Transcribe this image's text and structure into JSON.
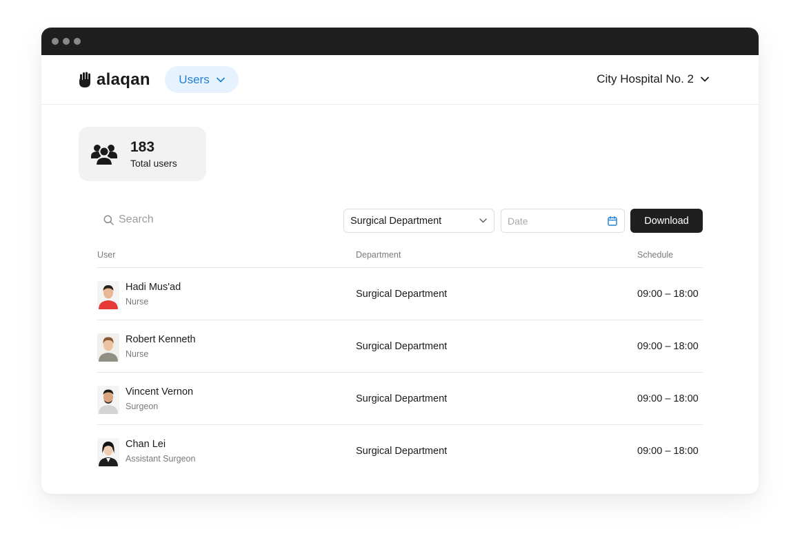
{
  "app": {
    "logo_text": "alaqan"
  },
  "nav": {
    "section_label": "Users"
  },
  "org": {
    "name": "City Hospital No. 2"
  },
  "stats": {
    "total_value": "183",
    "total_label": "Total users"
  },
  "filters": {
    "search_placeholder": "Search",
    "department_selected": "Surgical Department",
    "date_placeholder": "Date",
    "download_label": "Download"
  },
  "table": {
    "headers": {
      "user": "User",
      "department": "Department",
      "schedule": "Schedule"
    },
    "rows": [
      {
        "name": "Hadi Mus'ad",
        "role": "Nurse",
        "department": "Surgical Department",
        "schedule": "09:00 – 18:00",
        "avatar_color": "#e53935"
      },
      {
        "name": "Robert Kenneth",
        "role": "Nurse",
        "department": "Surgical Department",
        "schedule": "09:00 – 18:00",
        "avatar_color": "#9a9a8a"
      },
      {
        "name": "Vincent Vernon",
        "role": "Surgeon",
        "department": "Surgical Department",
        "schedule": "09:00 – 18:00",
        "avatar_color": "#d8d8d8"
      },
      {
        "name": "Chan Lei",
        "role": "Assistant Surgeon",
        "department": "Surgical Department",
        "schedule": "09:00 – 18:00",
        "avatar_color": "#2a2a2a"
      }
    ]
  },
  "colors": {
    "accent": "#1f7fd6",
    "accent_bg": "#e6f2fd",
    "dark": "#1f1f1f"
  },
  "icons": [
    "hand-logo-icon",
    "chevron-down-icon",
    "users-group-icon",
    "search-icon",
    "calendar-icon"
  ]
}
